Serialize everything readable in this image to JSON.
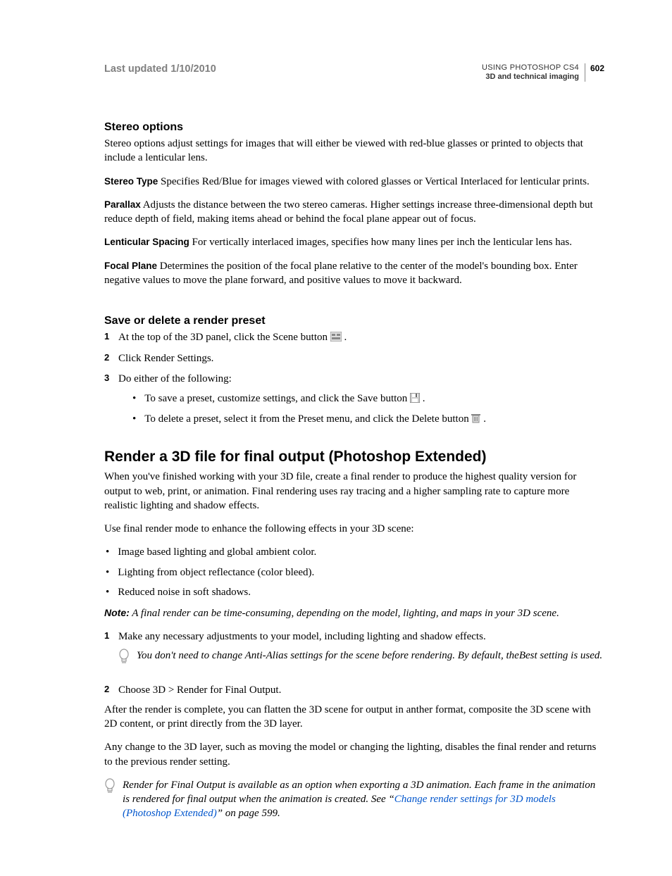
{
  "header": {
    "last_updated": "Last updated 1/10/2010",
    "using": "USING PHOTOSHOP CS4",
    "section": "3D and technical imaging",
    "page_number": "602"
  },
  "stereo": {
    "heading": "Stereo options",
    "intro": "Stereo options adjust settings for images that will either be viewed with red-blue glasses or printed to objects that include a lenticular lens.",
    "terms": {
      "stereo_type_label": "Stereo Type",
      "stereo_type_text": "  Specifies Red/Blue for images viewed with colored glasses or Vertical Interlaced for lenticular prints.",
      "parallax_label": "Parallax",
      "parallax_text": "  Adjusts the distance between the two stereo cameras. Higher settings increase three-dimensional depth but reduce depth of field, making items ahead or behind the focal plane appear out of focus.",
      "lenticular_label": "Lenticular Spacing",
      "lenticular_text": "  For vertically interlaced images, specifies how many lines per inch the lenticular lens has.",
      "focal_label": "Focal Plane",
      "focal_text": "  Determines the position of the focal plane relative to the center of the model's bounding box. Enter negative values to move the plane forward, and positive values to move it backward."
    }
  },
  "preset": {
    "heading": "Save or delete a render preset",
    "steps": {
      "n1": "1",
      "s1a": "At the top of the 3D panel, click the Scene button ",
      "s1b": ".",
      "n2": "2",
      "s2": "Click Render Settings.",
      "n3": "3",
      "s3": "Do either of the following:",
      "b1a": "To save a preset, customize settings, and click the Save button ",
      "b1b": ".",
      "b2a": "To delete a preset, select it from the Preset menu, and click the Delete button ",
      "b2b": "."
    }
  },
  "render": {
    "heading": "Render a 3D file for final output (Photoshop Extended)",
    "p1": "When you've finished working with your 3D file, create a final render to produce the highest quality version for output to web, print, or animation. Final rendering uses ray tracing and a higher sampling rate to capture more realistic lighting and shadow effects.",
    "p2": "Use final render mode to enhance the following effects in your 3D scene:",
    "bullets": {
      "b1": "Image based lighting and global ambient color.",
      "b2": "Lighting from object reflectance (color bleed).",
      "b3": "Reduced noise in soft shadows."
    },
    "note_label": "Note:",
    "note_text": "  A final render can be time-consuming, depending on the model, lighting, and maps in your 3D scene.",
    "steps": {
      "n1": "1",
      "s1": "Make any necessary adjustments to your model, including lighting and shadow effects.",
      "tip1": "You don't need to change Anti-Alias settings for the scene before rendering. By default, theBest setting is used.",
      "n2": "2",
      "s2": "Choose 3D > Render for Final Output."
    },
    "p3": "After the render is complete, you can flatten the 3D scene for output in anther format, composite the 3D scene with 2D content, or print directly from the 3D layer.",
    "p4": "Any change to the 3D layer, such as moving the model or changing the lighting, disables the final render and returns to the previous render setting.",
    "tip2a": "Render for Final Output is available as an option when exporting a 3D animation. Each frame in the animation is rendered for final output when the animation is created. See “",
    "tip2_link": "Change render settings for 3D models (Photoshop Extended)",
    "tip2b": "” on page 599."
  }
}
